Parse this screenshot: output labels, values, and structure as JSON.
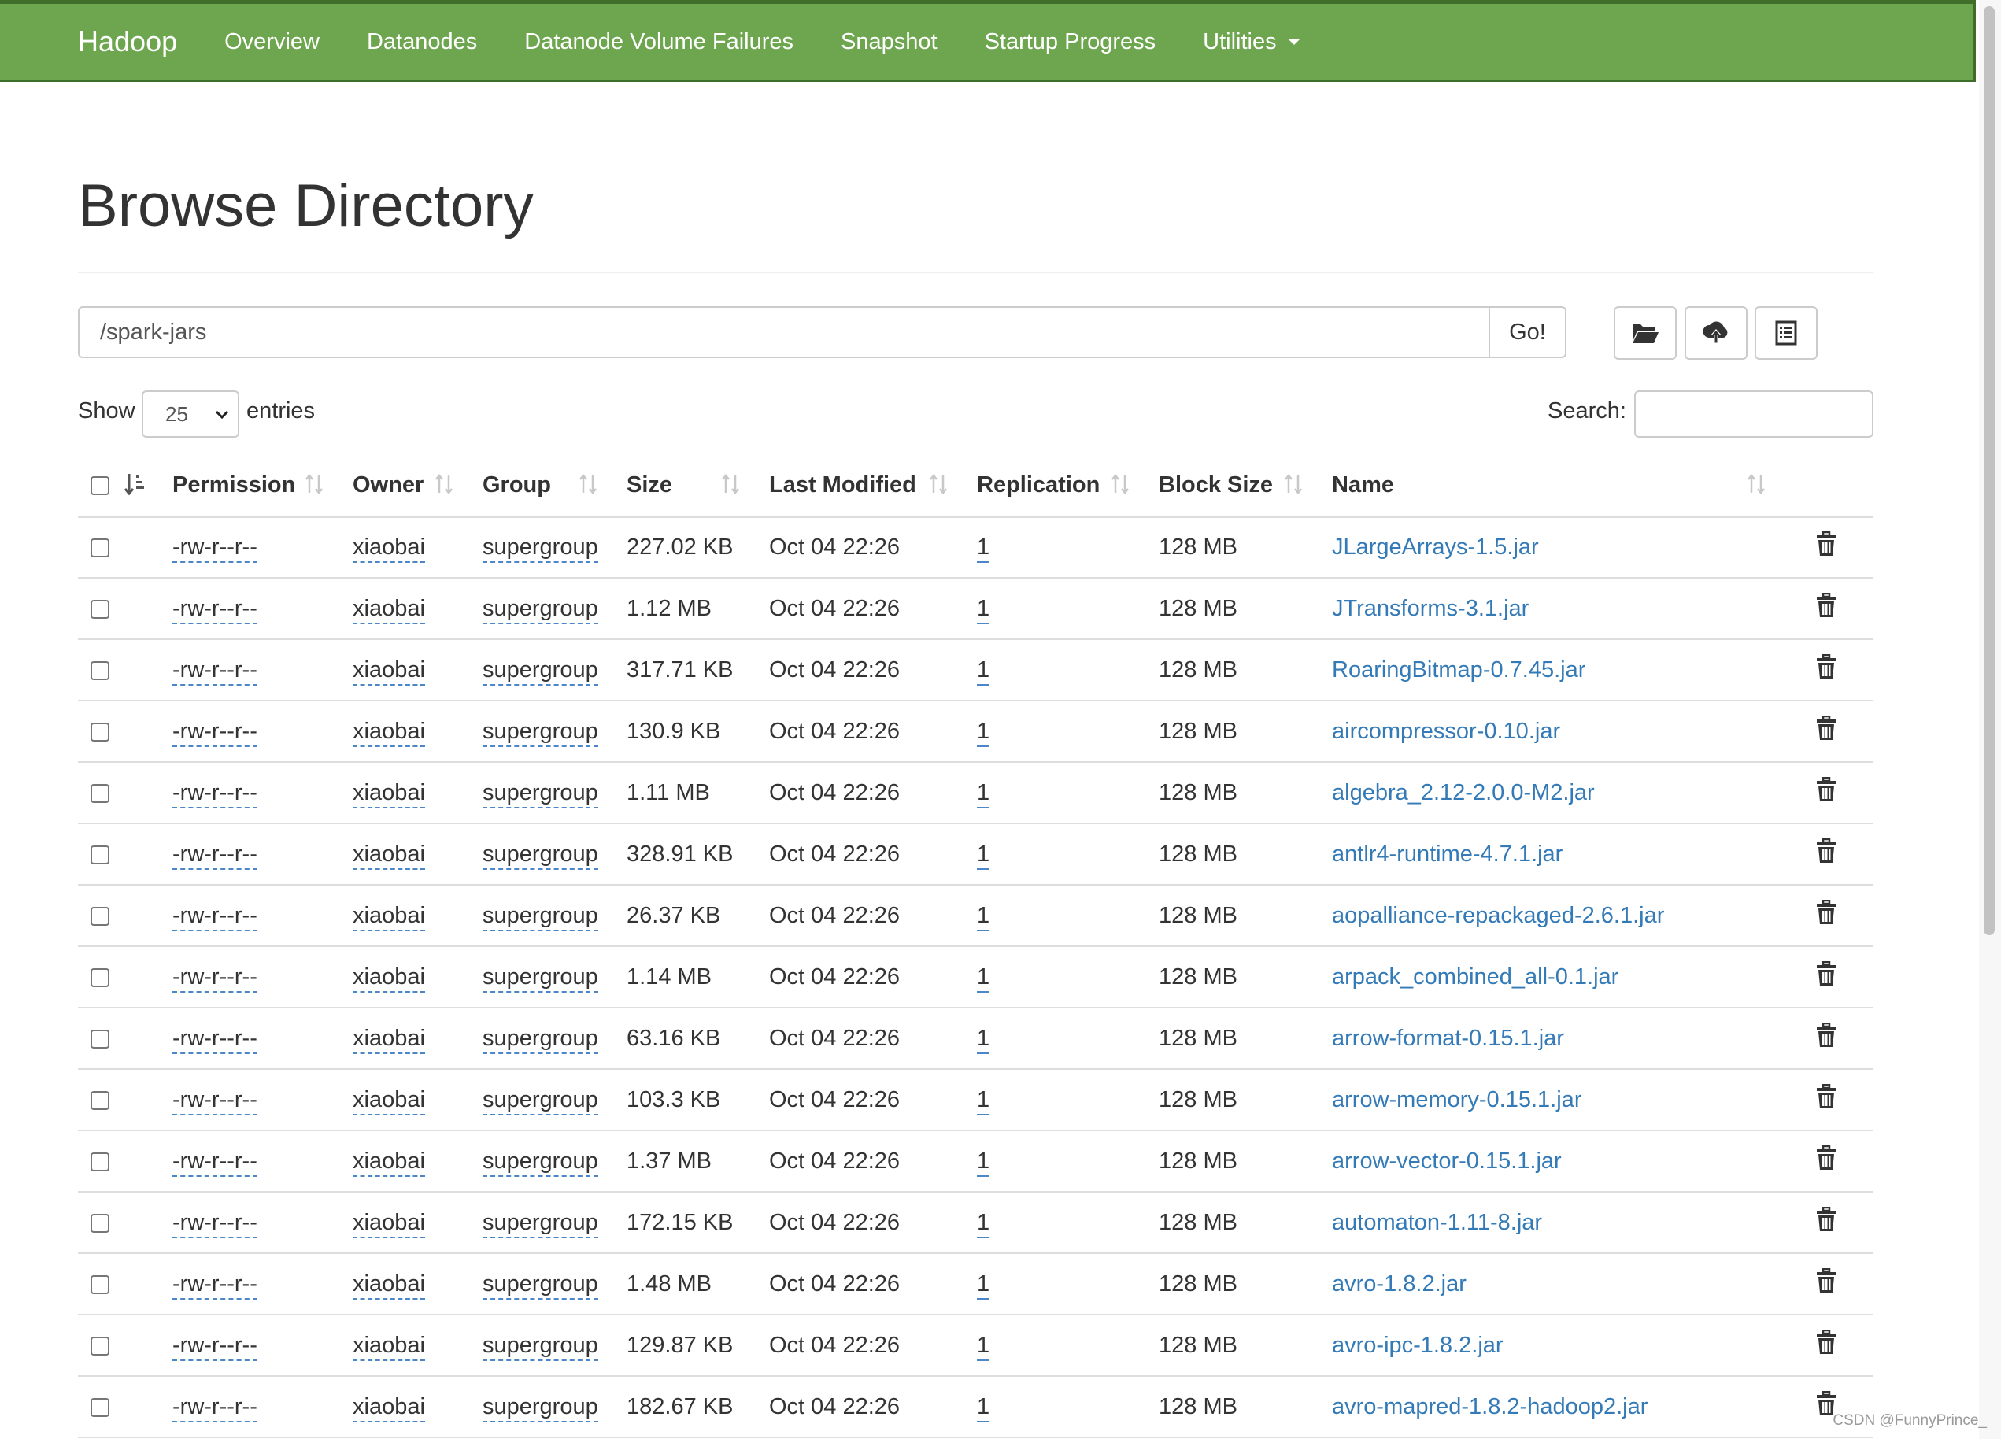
{
  "navbar": {
    "brand": "Hadoop",
    "items": [
      "Overview",
      "Datanodes",
      "Datanode Volume Failures",
      "Snapshot",
      "Startup Progress"
    ],
    "utilities": "Utilities",
    "background_color": "#6da64f"
  },
  "page": {
    "title": "Browse Directory"
  },
  "pathbar": {
    "path": "/spark-jars",
    "go_label": "Go!",
    "icons": [
      "folder-open-icon",
      "cloud-upload-icon",
      "list-icon"
    ]
  },
  "controls": {
    "show_label": "Show",
    "entries_value": "25",
    "entries_label": "entries",
    "search_label": "Search:",
    "search_value": ""
  },
  "table": {
    "columns": [
      "Permission",
      "Owner",
      "Group",
      "Size",
      "Last Modified",
      "Replication",
      "Block Size",
      "Name"
    ],
    "rows": [
      {
        "permission": "-rw-r--r--",
        "owner": "xiaobai",
        "group": "supergroup",
        "size": "227.02 KB",
        "modified": "Oct 04 22:26",
        "replication": "1",
        "block_size": "128 MB",
        "name": "JLargeArrays-1.5.jar"
      },
      {
        "permission": "-rw-r--r--",
        "owner": "xiaobai",
        "group": "supergroup",
        "size": "1.12 MB",
        "modified": "Oct 04 22:26",
        "replication": "1",
        "block_size": "128 MB",
        "name": "JTransforms-3.1.jar"
      },
      {
        "permission": "-rw-r--r--",
        "owner": "xiaobai",
        "group": "supergroup",
        "size": "317.71 KB",
        "modified": "Oct 04 22:26",
        "replication": "1",
        "block_size": "128 MB",
        "name": "RoaringBitmap-0.7.45.jar"
      },
      {
        "permission": "-rw-r--r--",
        "owner": "xiaobai",
        "group": "supergroup",
        "size": "130.9 KB",
        "modified": "Oct 04 22:26",
        "replication": "1",
        "block_size": "128 MB",
        "name": "aircompressor-0.10.jar"
      },
      {
        "permission": "-rw-r--r--",
        "owner": "xiaobai",
        "group": "supergroup",
        "size": "1.11 MB",
        "modified": "Oct 04 22:26",
        "replication": "1",
        "block_size": "128 MB",
        "name": "algebra_2.12-2.0.0-M2.jar"
      },
      {
        "permission": "-rw-r--r--",
        "owner": "xiaobai",
        "group": "supergroup",
        "size": "328.91 KB",
        "modified": "Oct 04 22:26",
        "replication": "1",
        "block_size": "128 MB",
        "name": "antlr4-runtime-4.7.1.jar"
      },
      {
        "permission": "-rw-r--r--",
        "owner": "xiaobai",
        "group": "supergroup",
        "size": "26.37 KB",
        "modified": "Oct 04 22:26",
        "replication": "1",
        "block_size": "128 MB",
        "name": "aopalliance-repackaged-2.6.1.jar"
      },
      {
        "permission": "-rw-r--r--",
        "owner": "xiaobai",
        "group": "supergroup",
        "size": "1.14 MB",
        "modified": "Oct 04 22:26",
        "replication": "1",
        "block_size": "128 MB",
        "name": "arpack_combined_all-0.1.jar"
      },
      {
        "permission": "-rw-r--r--",
        "owner": "xiaobai",
        "group": "supergroup",
        "size": "63.16 KB",
        "modified": "Oct 04 22:26",
        "replication": "1",
        "block_size": "128 MB",
        "name": "arrow-format-0.15.1.jar"
      },
      {
        "permission": "-rw-r--r--",
        "owner": "xiaobai",
        "group": "supergroup",
        "size": "103.3 KB",
        "modified": "Oct 04 22:26",
        "replication": "1",
        "block_size": "128 MB",
        "name": "arrow-memory-0.15.1.jar"
      },
      {
        "permission": "-rw-r--r--",
        "owner": "xiaobai",
        "group": "supergroup",
        "size": "1.37 MB",
        "modified": "Oct 04 22:26",
        "replication": "1",
        "block_size": "128 MB",
        "name": "arrow-vector-0.15.1.jar"
      },
      {
        "permission": "-rw-r--r--",
        "owner": "xiaobai",
        "group": "supergroup",
        "size": "172.15 KB",
        "modified": "Oct 04 22:26",
        "replication": "1",
        "block_size": "128 MB",
        "name": "automaton-1.11-8.jar"
      },
      {
        "permission": "-rw-r--r--",
        "owner": "xiaobai",
        "group": "supergroup",
        "size": "1.48 MB",
        "modified": "Oct 04 22:26",
        "replication": "1",
        "block_size": "128 MB",
        "name": "avro-1.8.2.jar"
      },
      {
        "permission": "-rw-r--r--",
        "owner": "xiaobai",
        "group": "supergroup",
        "size": "129.87 KB",
        "modified": "Oct 04 22:26",
        "replication": "1",
        "block_size": "128 MB",
        "name": "avro-ipc-1.8.2.jar"
      },
      {
        "permission": "-rw-r--r--",
        "owner": "xiaobai",
        "group": "supergroup",
        "size": "182.67 KB",
        "modified": "Oct 04 22:26",
        "replication": "1",
        "block_size": "128 MB",
        "name": "avro-mapred-1.8.2-hadoop2.jar"
      }
    ]
  },
  "watermark": "CSDN @FunnyPrince_"
}
